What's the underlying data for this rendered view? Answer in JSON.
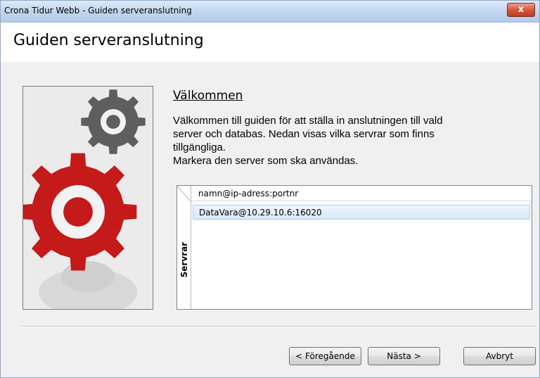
{
  "window": {
    "title": "Crona Tidur Webb - Guiden serveranslutning",
    "close_glyph": "x"
  },
  "header": {
    "heading": "Guiden serveranslutning"
  },
  "illustration": {
    "icon": "gears-illustration",
    "colors": {
      "top_gear": "#5e5e5e",
      "bottom_gear": "#c41a1a",
      "background": "#ebebeb"
    }
  },
  "welcome": {
    "title": "Välkommen",
    "lines": [
      "Välkommen till guiden för att ställa in anslutningen till vald",
      "server och databas. Nedan visas vilka servrar som finns",
      "tillgängliga.",
      "Markera den server som ska användas."
    ]
  },
  "server_list": {
    "side_tab_label": "Servrar",
    "column_header": "namn@ip-adress:portnr",
    "rows": [
      "DataVara@10.29.10.6:16020"
    ],
    "selected_index": 0
  },
  "buttons": {
    "previous": "< Föregående",
    "next": "Nästa >",
    "cancel": "Avbryt"
  }
}
